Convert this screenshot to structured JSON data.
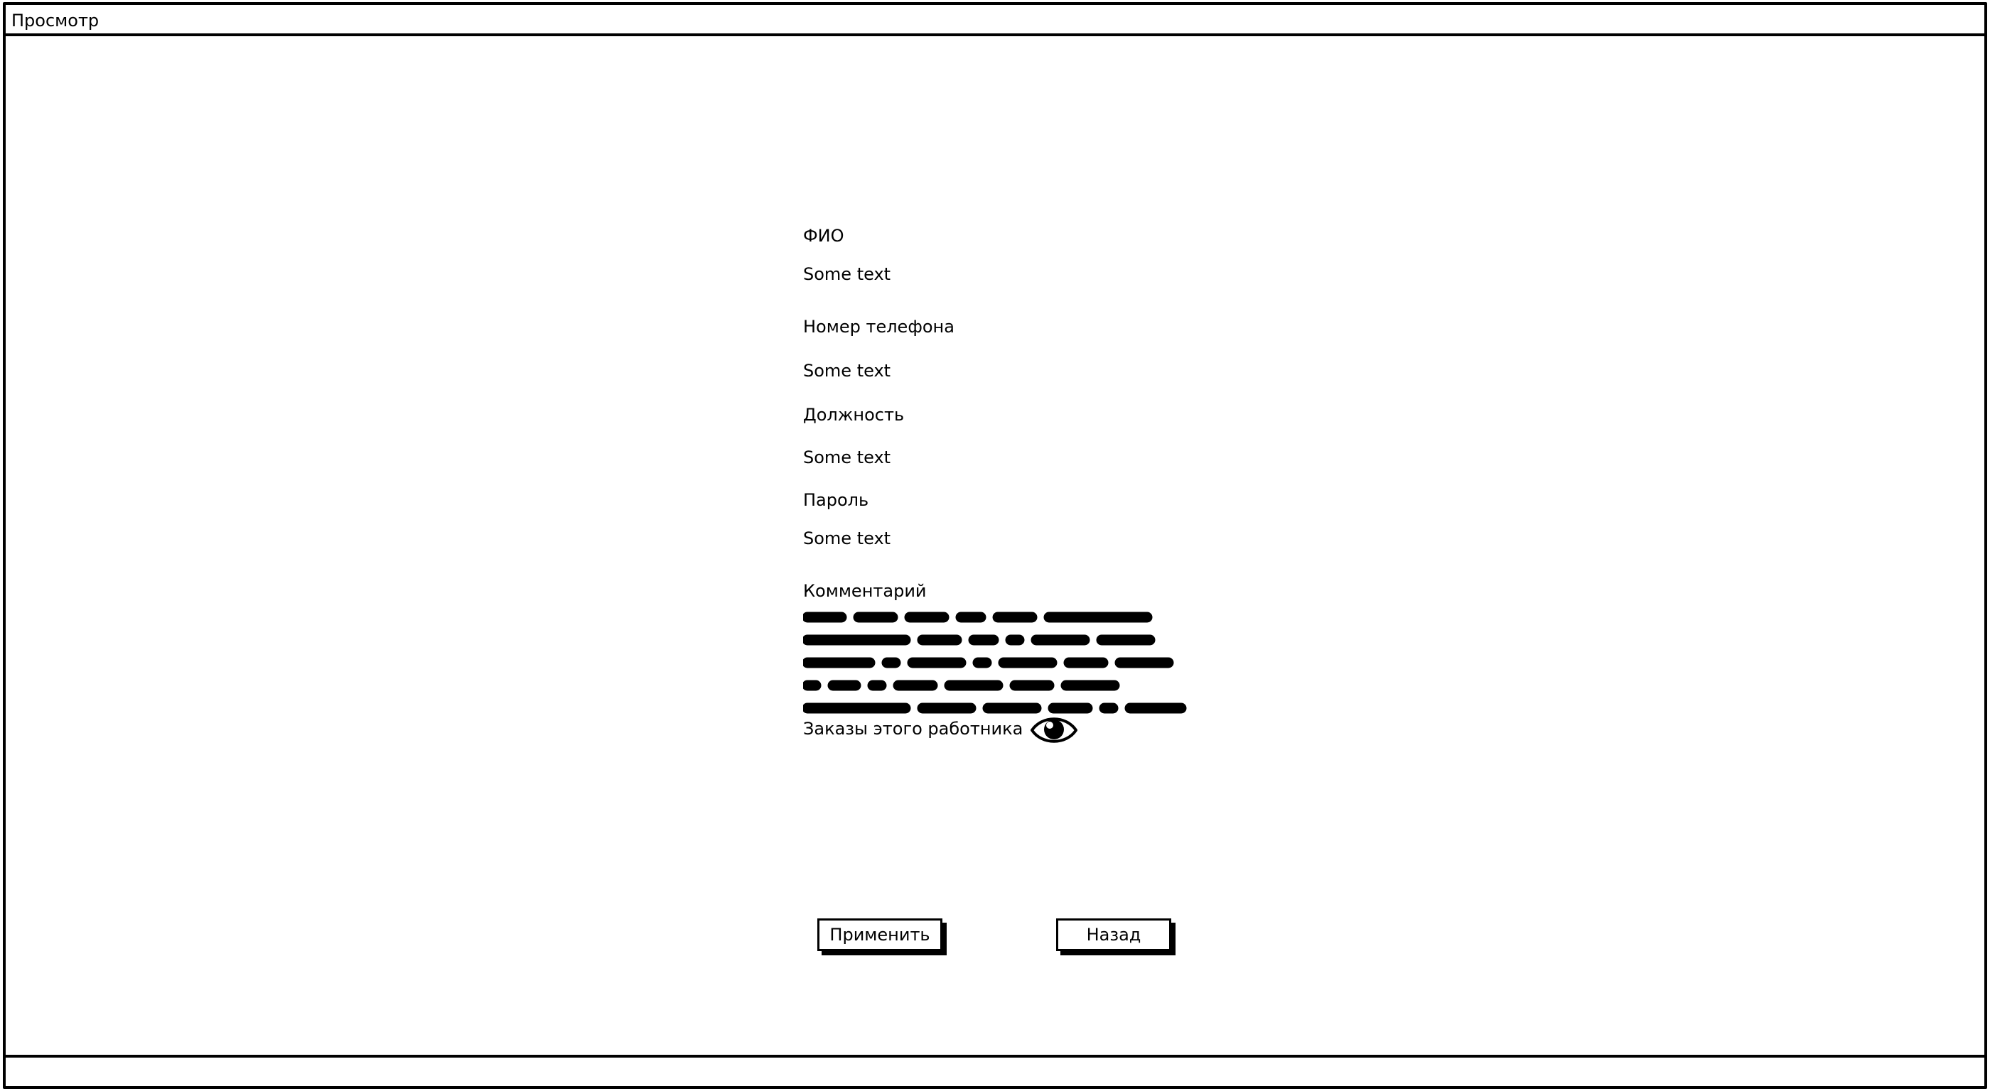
{
  "window": {
    "title": "Просмотр"
  },
  "form": {
    "fio_label": "ФИО",
    "fio_value": "Some text",
    "phone_label": "Номер телефона",
    "phone_value": "Some text",
    "position_label": "Должность",
    "position_value": "Some text",
    "password_label": "Пароль",
    "password_value": "Some text",
    "comment_label": "Комментарий",
    "orders_label": "Заказы этого работника"
  },
  "icons": {
    "orders_view": "eye-icon"
  },
  "buttons": {
    "apply_label": "Применить",
    "back_label": "Назад"
  }
}
